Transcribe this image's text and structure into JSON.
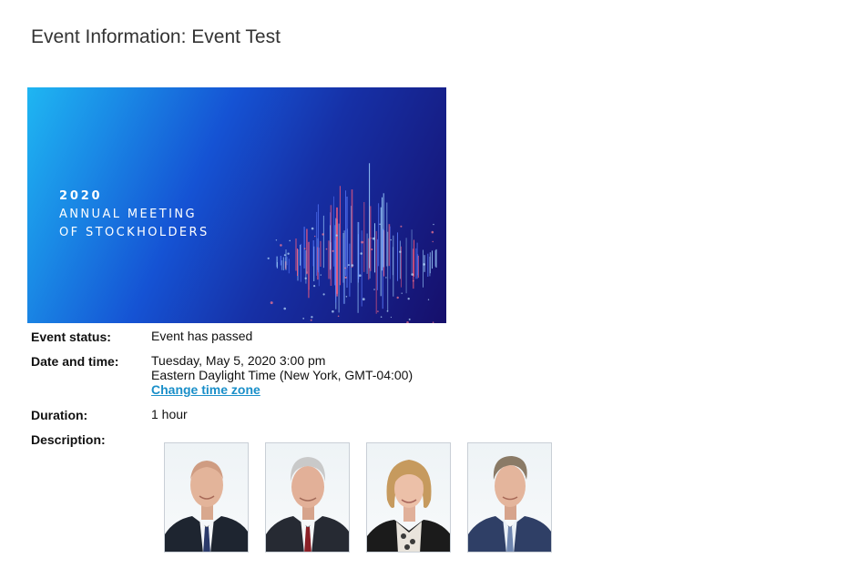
{
  "page": {
    "title": "Event Information: Event Test"
  },
  "banner": {
    "year": "2020",
    "line1": "ANNUAL MEETING",
    "line2": "OF STOCKHOLDERS"
  },
  "details": {
    "status_label": "Event status:",
    "status_value": "Event has passed",
    "datetime_label": "Date and time:",
    "datetime_line1": "Tuesday, May 5, 2020 3:00 pm",
    "datetime_line2": "Eastern Daylight Time (New York, GMT-04:00)",
    "change_tz_link": "Change time zone",
    "duration_label": "Duration:",
    "duration_value": "1 hour",
    "description_label": "Description:"
  },
  "colors": {
    "link": "#1a8fc9",
    "banner_light": "#1fb6f2",
    "banner_dark": "#160f6b"
  }
}
